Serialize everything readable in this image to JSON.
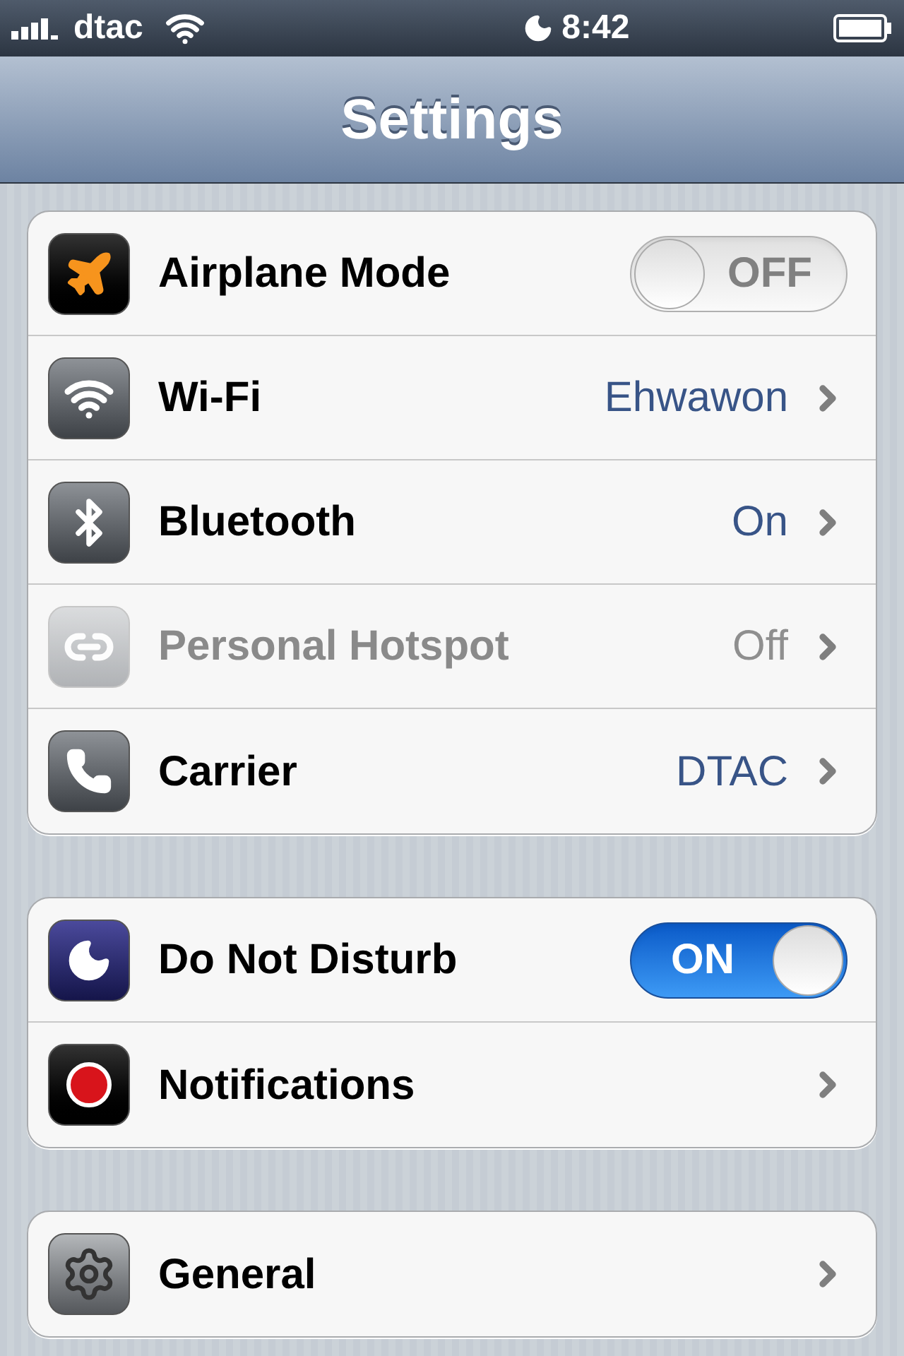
{
  "status_bar": {
    "carrier": "dtac",
    "time": "8:42"
  },
  "nav_bar": {
    "title": "Settings"
  },
  "groups": [
    {
      "rows": [
        {
          "label": "Airplane Mode",
          "kind": "toggle",
          "on": false,
          "toggle_text": "OFF",
          "disabled": false
        },
        {
          "label": "Wi-Fi",
          "kind": "link",
          "value": "Ehwawon",
          "disabled": false
        },
        {
          "label": "Bluetooth",
          "kind": "link",
          "value": "On",
          "disabled": false
        },
        {
          "label": "Personal Hotspot",
          "kind": "link",
          "value": "Off",
          "disabled": true
        },
        {
          "label": "Carrier",
          "kind": "link",
          "value": "DTAC",
          "disabled": false
        }
      ]
    },
    {
      "rows": [
        {
          "label": "Do Not Disturb",
          "kind": "toggle",
          "on": true,
          "toggle_text": "ON",
          "disabled": false
        },
        {
          "label": "Notifications",
          "kind": "link",
          "disabled": false
        }
      ]
    },
    {
      "rows": [
        {
          "label": "General",
          "kind": "link",
          "disabled": false
        }
      ]
    }
  ]
}
